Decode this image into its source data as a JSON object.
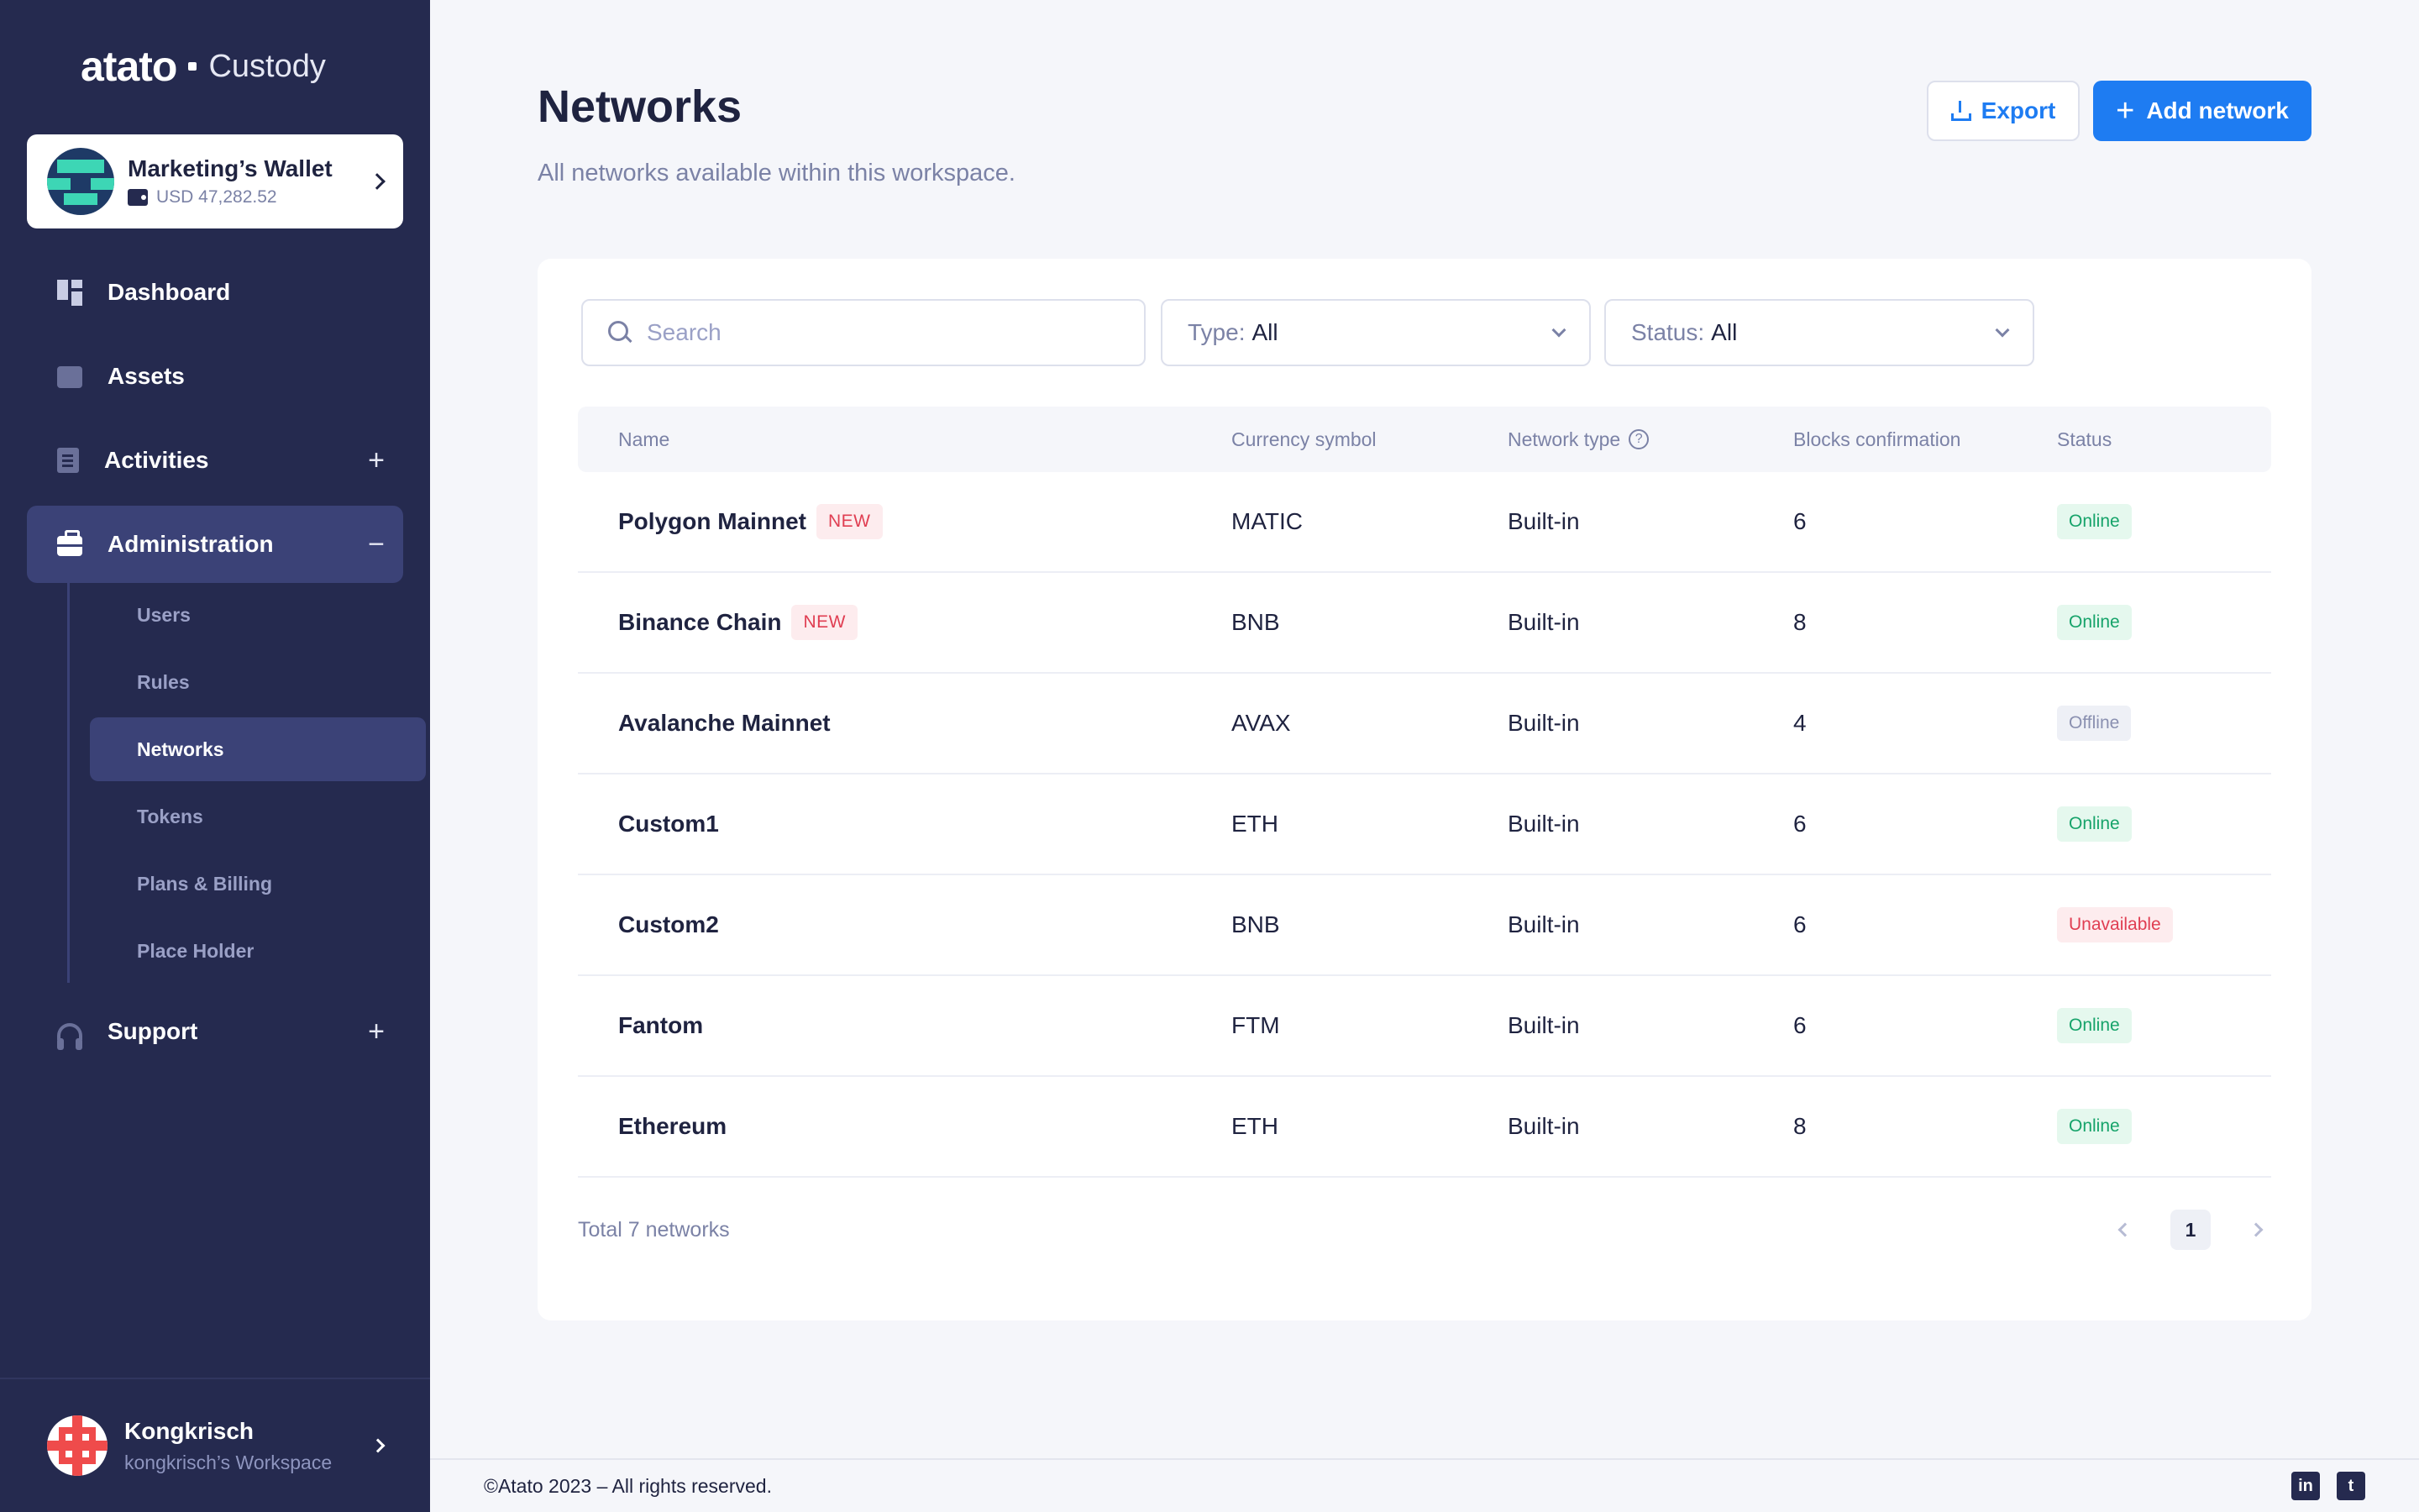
{
  "brand": {
    "logo": "atato",
    "product": "Custody"
  },
  "wallet": {
    "name": "Marketing’s Wallet",
    "balance": "USD 47,282.52"
  },
  "nav": {
    "dashboard": "Dashboard",
    "assets": "Assets",
    "activities": "Activities",
    "administration": "Administration",
    "support": "Support"
  },
  "subnav": {
    "users": "Users",
    "rules": "Rules",
    "networks": "Networks",
    "tokens": "Tokens",
    "plans": "Plans & Billing",
    "placeholder": "Place Holder"
  },
  "user": {
    "name": "Kongkrisch",
    "workspace": "kongkrisch’s Workspace"
  },
  "page": {
    "title": "Networks",
    "subtitle": "All networks available within this workspace.",
    "export_label": "Export",
    "add_label": "Add network"
  },
  "filters": {
    "search_placeholder": "Search",
    "type_label": "Type:",
    "type_value": "All",
    "status_label": "Status:",
    "status_value": "All"
  },
  "table": {
    "headers": {
      "name": "Name",
      "currency": "Currency symbol",
      "type": "Network type",
      "blocks": "Blocks confirmation",
      "status": "Status"
    },
    "rows": [
      {
        "name": "Polygon Mainnet",
        "badge": "NEW",
        "currency": "MATIC",
        "type": "Built-in",
        "blocks": "6",
        "status": "Online"
      },
      {
        "name": "Binance Chain",
        "badge": "NEW",
        "currency": "BNB",
        "type": "Built-in",
        "blocks": "8",
        "status": "Online"
      },
      {
        "name": "Avalanche Mainnet",
        "badge": "",
        "currency": "AVAX",
        "type": "Built-in",
        "blocks": "4",
        "status": "Offline"
      },
      {
        "name": "Custom1",
        "badge": "",
        "currency": "ETH",
        "type": "Built-in",
        "blocks": "6",
        "status": "Online"
      },
      {
        "name": "Custom2",
        "badge": "",
        "currency": "BNB",
        "type": "Built-in",
        "blocks": "6",
        "status": "Unavailable"
      },
      {
        "name": "Fantom",
        "badge": "",
        "currency": "FTM",
        "type": "Built-in",
        "blocks": "6",
        "status": "Online"
      },
      {
        "name": "Ethereum",
        "badge": "",
        "currency": "ETH",
        "type": "Built-in",
        "blocks": "8",
        "status": "Online"
      }
    ],
    "total": "Total 7 networks",
    "current_page": "1"
  },
  "footer": {
    "copyright": "©Atato 2023 – All rights reserved.",
    "linkedin": "in",
    "twitter": "t"
  },
  "colors": {
    "sidebar": "#252a4f",
    "accent": "#1e7cf2",
    "online": "#16a36a",
    "unavailable": "#e03e52"
  }
}
